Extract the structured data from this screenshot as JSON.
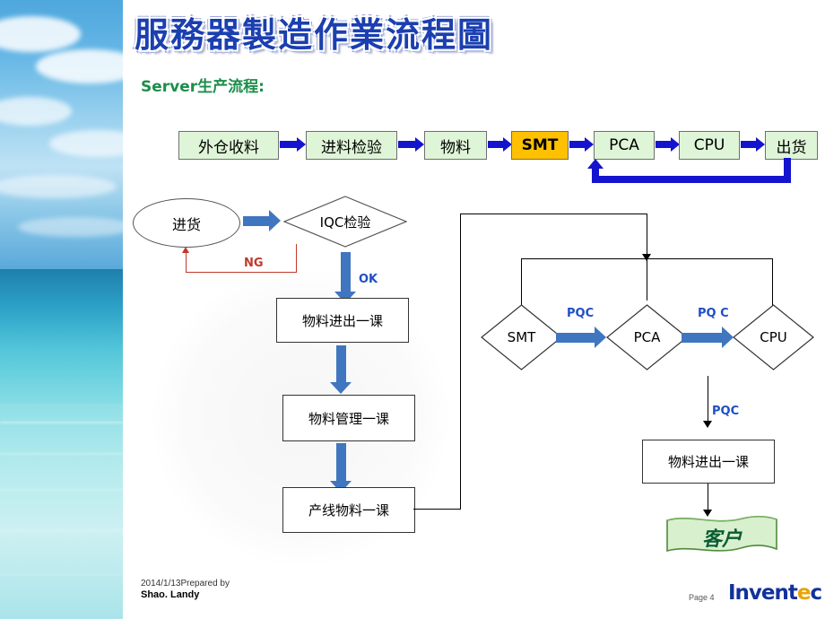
{
  "title": "服務器製造作業流程圖",
  "subtitle": "Server生产流程:",
  "colors": {
    "chain_fill": "#dff5d8",
    "chain_highlight": "#ffc000",
    "chain_arrow": "#1414cf",
    "thick_arrow": "#3f76bf",
    "ng_red": "#c0392b",
    "ok_blue": "#1f4fc4",
    "title_blue": "#1b3fb0",
    "subtitle_green": "#1b8f4a",
    "customer_green": "#0a5c33",
    "logo_blue": "#12329b"
  },
  "chain": {
    "steps": [
      {
        "label": "外仓收料",
        "highlight": false
      },
      {
        "label": "进料检验",
        "highlight": false
      },
      {
        "label": "物料",
        "highlight": false
      },
      {
        "label": "SMT",
        "highlight": true
      },
      {
        "label": "PCA",
        "highlight": false
      },
      {
        "label": "CPU",
        "highlight": false
      },
      {
        "label": "出货",
        "highlight": false
      }
    ]
  },
  "flow": {
    "incoming": "进货",
    "iqc": "IQC检验",
    "ng_label": "NG",
    "ok_label": "OK",
    "steps": [
      "物料进出一课",
      "物料管理一课",
      "产线物料一课"
    ],
    "stations": [
      "SMT",
      "PCA",
      "CPU"
    ],
    "pqc_1": "PQC",
    "pqc_2": "PQ C",
    "pqc_3": "PQC",
    "warehouse_out": "物料进出一课",
    "customer": "客户"
  },
  "footer": {
    "date_prepared": "2014/1/13Prepared by",
    "author": "Shao. Landy",
    "page": "Page 4",
    "logo_a": "Invent",
    "logo_tick": "e",
    "logo_b": "c"
  }
}
